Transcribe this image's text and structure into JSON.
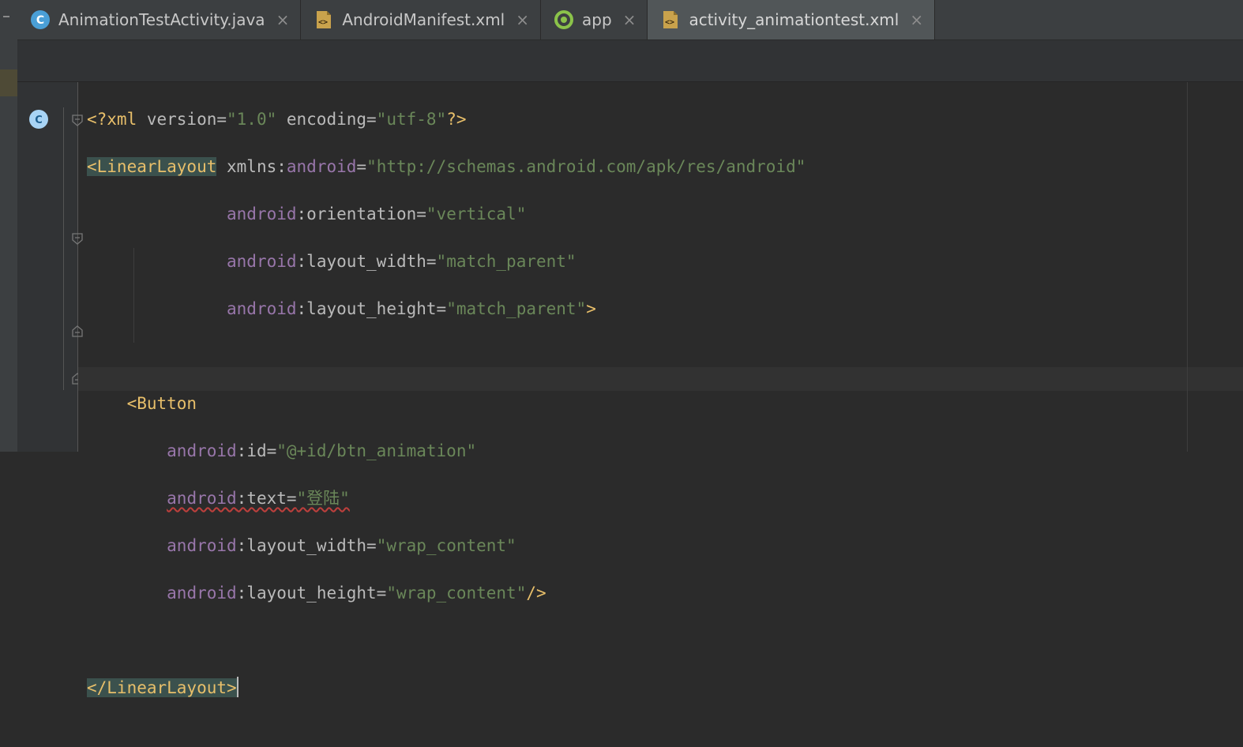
{
  "tabs": [
    {
      "label": "AnimationTestActivity.java",
      "icon": "java-class-icon",
      "close": "×",
      "active": false
    },
    {
      "label": "AndroidManifest.xml",
      "icon": "xml-file-icon",
      "close": "×",
      "active": false
    },
    {
      "label": "app",
      "icon": "android-module-icon",
      "close": "×",
      "active": false
    },
    {
      "label": "activity_animationtest.xml",
      "icon": "xml-file-icon",
      "close": "×",
      "active": true
    }
  ],
  "gutter": {
    "run_icon": "class-c-icon",
    "run_letter": "C"
  },
  "code": {
    "l1": {
      "open": "<?xml",
      "version_attr": " version=",
      "version_val": "\"1.0\"",
      "enc_attr": " encoding=",
      "enc_val": "\"utf-8\"",
      "close": "?>"
    },
    "l2": {
      "tag": "<LinearLayout",
      "xmlns": " xmlns:",
      "ns": "android",
      "eq": "=",
      "val": "\"http://schemas.android.com/apk/res/android\""
    },
    "l3": {
      "ns": "android",
      "attr": ":orientation=",
      "val": "\"vertical\""
    },
    "l4": {
      "ns": "android",
      "attr": ":layout_width=",
      "val": "\"match_parent\""
    },
    "l5": {
      "ns": "android",
      "attr": ":layout_height=",
      "val": "\"match_parent\"",
      "close": ">"
    },
    "l7": {
      "tag": "<Button"
    },
    "l8": {
      "ns": "android",
      "attr": ":id=",
      "val": "\"@+id/btn_animation\""
    },
    "l9": {
      "ns": "android",
      "attr": ":text=",
      "val": "\"登陆\""
    },
    "l10": {
      "ns": "android",
      "attr": ":layout_width=",
      "val": "\"wrap_content\""
    },
    "l11": {
      "ns": "android",
      "attr": ":layout_height=",
      "val": "\"wrap_content\"",
      "close": "/>"
    },
    "l13": {
      "tag": "</LinearLayout>"
    }
  },
  "colors": {
    "tag": "#e8bf6a",
    "namespace": "#9876aa",
    "value": "#6a8759",
    "attr": "#bababa",
    "background": "#2b2b2b"
  }
}
